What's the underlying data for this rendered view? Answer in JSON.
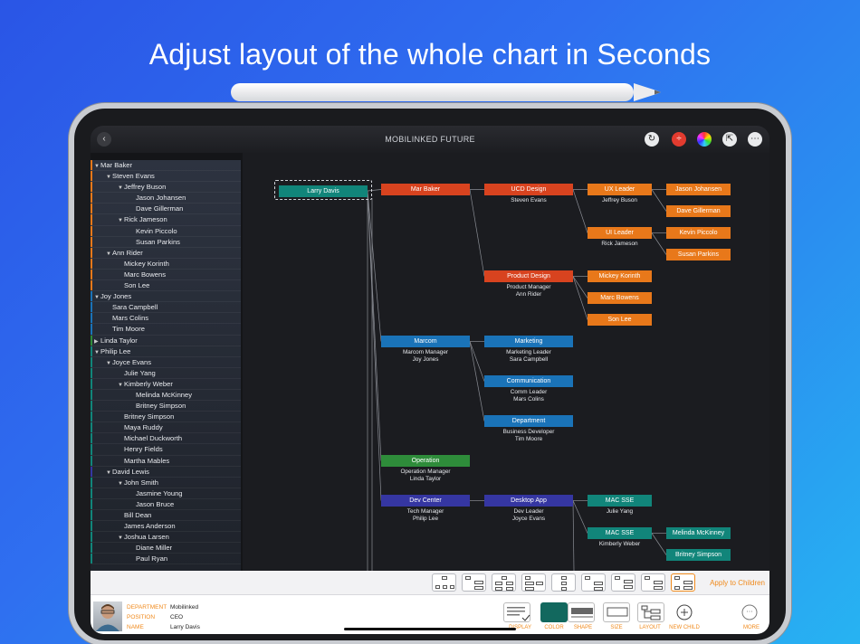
{
  "headline": "Adjust layout of the whole chart in Seconds",
  "app": {
    "title": "MOBILINKED FUTURE",
    "colors": {
      "bg": "#141518",
      "accent": "#f08a1c",
      "orange": "#e8781a",
      "darkorange": "#d8431f",
      "blue": "#1a73b8",
      "teal": "#11857a",
      "indigo": "#3536a2",
      "green": "#2e8c3a"
    }
  },
  "toolbar_icons": [
    "back-icon",
    "refresh-icon",
    "split-icon",
    "color-wheel-icon",
    "share-icon",
    "more-icon"
  ],
  "outline": [
    {
      "label": "Mar Baker",
      "level": 0,
      "exp": "down",
      "c": "#e8781a"
    },
    {
      "label": "Steven Evans",
      "level": 1,
      "exp": "down",
      "c": "#e8781a"
    },
    {
      "label": "Jeffrey Buson",
      "level": 2,
      "exp": "down",
      "c": "#e8781a"
    },
    {
      "label": "Jason Johansen",
      "level": 3,
      "exp": "",
      "c": "#e8781a"
    },
    {
      "label": "Dave Gillerman",
      "level": 3,
      "exp": "",
      "c": "#e8781a"
    },
    {
      "label": "Rick Jameson",
      "level": 2,
      "exp": "down",
      "c": "#e8781a"
    },
    {
      "label": "Kevin Piccolo",
      "level": 3,
      "exp": "",
      "c": "#e8781a"
    },
    {
      "label": "Susan Parkins",
      "level": 3,
      "exp": "",
      "c": "#e8781a"
    },
    {
      "label": "Ann Rider",
      "level": 1,
      "exp": "down",
      "c": "#e8781a"
    },
    {
      "label": "Mickey Korinth",
      "level": 2,
      "exp": "",
      "c": "#e8781a"
    },
    {
      "label": "Marc Bowens",
      "level": 2,
      "exp": "",
      "c": "#e8781a"
    },
    {
      "label": "Son Lee",
      "level": 2,
      "exp": "",
      "c": "#e8781a"
    },
    {
      "label": "Joy Jones",
      "level": 0,
      "exp": "down",
      "c": "#1a73b8"
    },
    {
      "label": "Sara Campbell",
      "level": 1,
      "exp": "",
      "c": "#1a73b8"
    },
    {
      "label": "Mars Colins",
      "level": 1,
      "exp": "",
      "c": "#1a73b8"
    },
    {
      "label": "Tim Moore",
      "level": 1,
      "exp": "",
      "c": "#1a73b8"
    },
    {
      "label": "Linda Taylor",
      "level": 0,
      "exp": "right",
      "c": "#2e8c3a"
    },
    {
      "label": "Philip Lee",
      "level": 0,
      "exp": "down",
      "c": "#11857a"
    },
    {
      "label": "Joyce Evans",
      "level": 1,
      "exp": "down",
      "c": "#11857a"
    },
    {
      "label": "Julie Yang",
      "level": 2,
      "exp": "",
      "c": "#11857a"
    },
    {
      "label": "Kimberly Weber",
      "level": 2,
      "exp": "down",
      "c": "#11857a"
    },
    {
      "label": "Melinda McKinney",
      "level": 3,
      "exp": "",
      "c": "#11857a"
    },
    {
      "label": "Britney Simpson",
      "level": 3,
      "exp": "",
      "c": "#11857a"
    },
    {
      "label": "Britney Simpson",
      "level": 2,
      "exp": "",
      "c": "#11857a"
    },
    {
      "label": "Maya Ruddy",
      "level": 2,
      "exp": "",
      "c": "#11857a"
    },
    {
      "label": "Michael Duckworth",
      "level": 2,
      "exp": "",
      "c": "#11857a"
    },
    {
      "label": "Henry Fields",
      "level": 2,
      "exp": "",
      "c": "#11857a"
    },
    {
      "label": "Martha Mables",
      "level": 2,
      "exp": "",
      "c": "#11857a"
    },
    {
      "label": "David Lewis",
      "level": 1,
      "exp": "down",
      "c": "#3536a2"
    },
    {
      "label": "John Smith",
      "level": 2,
      "exp": "down",
      "c": "#11857a"
    },
    {
      "label": "Jasmine Young",
      "level": 3,
      "exp": "",
      "c": "#11857a"
    },
    {
      "label": "Jason Bruce",
      "level": 3,
      "exp": "",
      "c": "#11857a"
    },
    {
      "label": "Bill Dean",
      "level": 2,
      "exp": "",
      "c": "#11857a"
    },
    {
      "label": "James Anderson",
      "level": 2,
      "exp": "",
      "c": "#11857a"
    },
    {
      "label": "Joshua Larsen",
      "level": 2,
      "exp": "down",
      "c": "#11857a"
    },
    {
      "label": "Diane Miller",
      "level": 3,
      "exp": "",
      "c": "#11857a"
    },
    {
      "label": "Paul Ryan",
      "level": 3,
      "exp": "",
      "c": "#11857a"
    }
  ],
  "chart": {
    "root": {
      "label": "Larry Davis"
    },
    "nodes": {
      "marbaker": {
        "label": "Mar Baker"
      },
      "ucd": {
        "label": "UCD Design",
        "sub": "Steven Evans"
      },
      "uxleader": {
        "label": "UX Leader",
        "sub": "Jeffrey Buson"
      },
      "jason": {
        "label": "Jason Johansen"
      },
      "dave": {
        "label": "Dave Gillerman"
      },
      "uileader": {
        "label": "UI Leader",
        "sub": "Rick Jameson"
      },
      "kevin": {
        "label": "Kevin Piccolo"
      },
      "susan": {
        "label": "Susan Parkins"
      },
      "product": {
        "label": "Product Design",
        "sub1": "Product Manager",
        "sub2": "Ann Rider"
      },
      "mickey": {
        "label": "Mickey Korinth"
      },
      "marc": {
        "label": "Marc Bowens"
      },
      "son": {
        "label": "Son Lee"
      },
      "marcom": {
        "label": "Marcom",
        "sub1": "Marcom Manager",
        "sub2": "Joy Jones"
      },
      "marketing": {
        "label": "Marketing",
        "sub1": "Marketing Leader",
        "sub2": "Sara Campbell"
      },
      "comm": {
        "label": "Communication",
        "sub1": "Comm Leader",
        "sub2": "Mars Colins"
      },
      "dept": {
        "label": "Department",
        "sub1": "Business Developer",
        "sub2": "Tim Moore"
      },
      "operation": {
        "label": "Operation",
        "sub1": "Operation Manager",
        "sub2": "Linda Taylor"
      },
      "devcenter": {
        "label": "Dev Center",
        "sub1": "Tech Manager",
        "sub2": "Philip Lee"
      },
      "desktop": {
        "label": "Desktop App",
        "sub1": "Dev Leader",
        "sub2": "Joyce Evans"
      },
      "macsse1": {
        "label": "MAC SSE",
        "sub": "Julie Yang"
      },
      "macsse2": {
        "label": "MAC SSE",
        "sub": "Kimberly Weber"
      },
      "melinda": {
        "label": "Melinda McKinney"
      },
      "britney": {
        "label": "Britney Simpson"
      }
    }
  },
  "layout_bar": {
    "apply_label": "Apply to Children",
    "options": [
      "layout-option-1",
      "layout-option-2",
      "layout-option-3",
      "layout-option-4",
      "layout-option-5",
      "layout-option-6",
      "layout-option-7",
      "layout-option-8",
      "layout-option-9"
    ],
    "selected": 8
  },
  "info": {
    "department_label": "DEPARTMENT",
    "department": "Mobilinked",
    "position_label": "POSITION",
    "position": "CEO",
    "name_label": "NAME",
    "name": "Larry Davis"
  },
  "tools": {
    "display": "DISPLAY",
    "color": "COLOR",
    "shape": "SHAPE",
    "size": "SIZE",
    "layout": "LAYOUT",
    "new_child": "NEW CHILD",
    "more": "MORE"
  }
}
